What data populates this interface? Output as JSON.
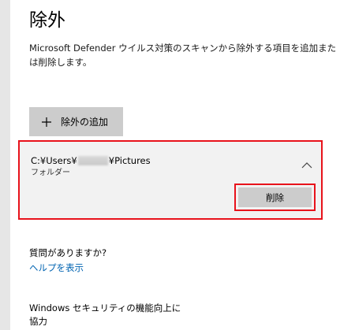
{
  "page": {
    "title": "除外",
    "description": "Microsoft Defender ウイルス対策のスキャンから除外する項目を追加または削除します。"
  },
  "add_exclusion": {
    "label": "除外の追加",
    "icon": "plus-icon"
  },
  "exclusion_item": {
    "path_prefix": "C:¥Users¥",
    "path_suffix": "¥Pictures",
    "type": "フォルダー",
    "toggle_icon": "chevron-up-icon",
    "remove_label": "削除"
  },
  "faq": {
    "title": "質問がありますか?",
    "help_link": "ヘルプを表示"
  },
  "improve": {
    "title": "Windows セキュリティの機能向上に協力"
  },
  "colors": {
    "highlight": "#e8121b",
    "link": "#0063b1",
    "button": "#cccccc",
    "item_background": "#f2f2f2"
  }
}
